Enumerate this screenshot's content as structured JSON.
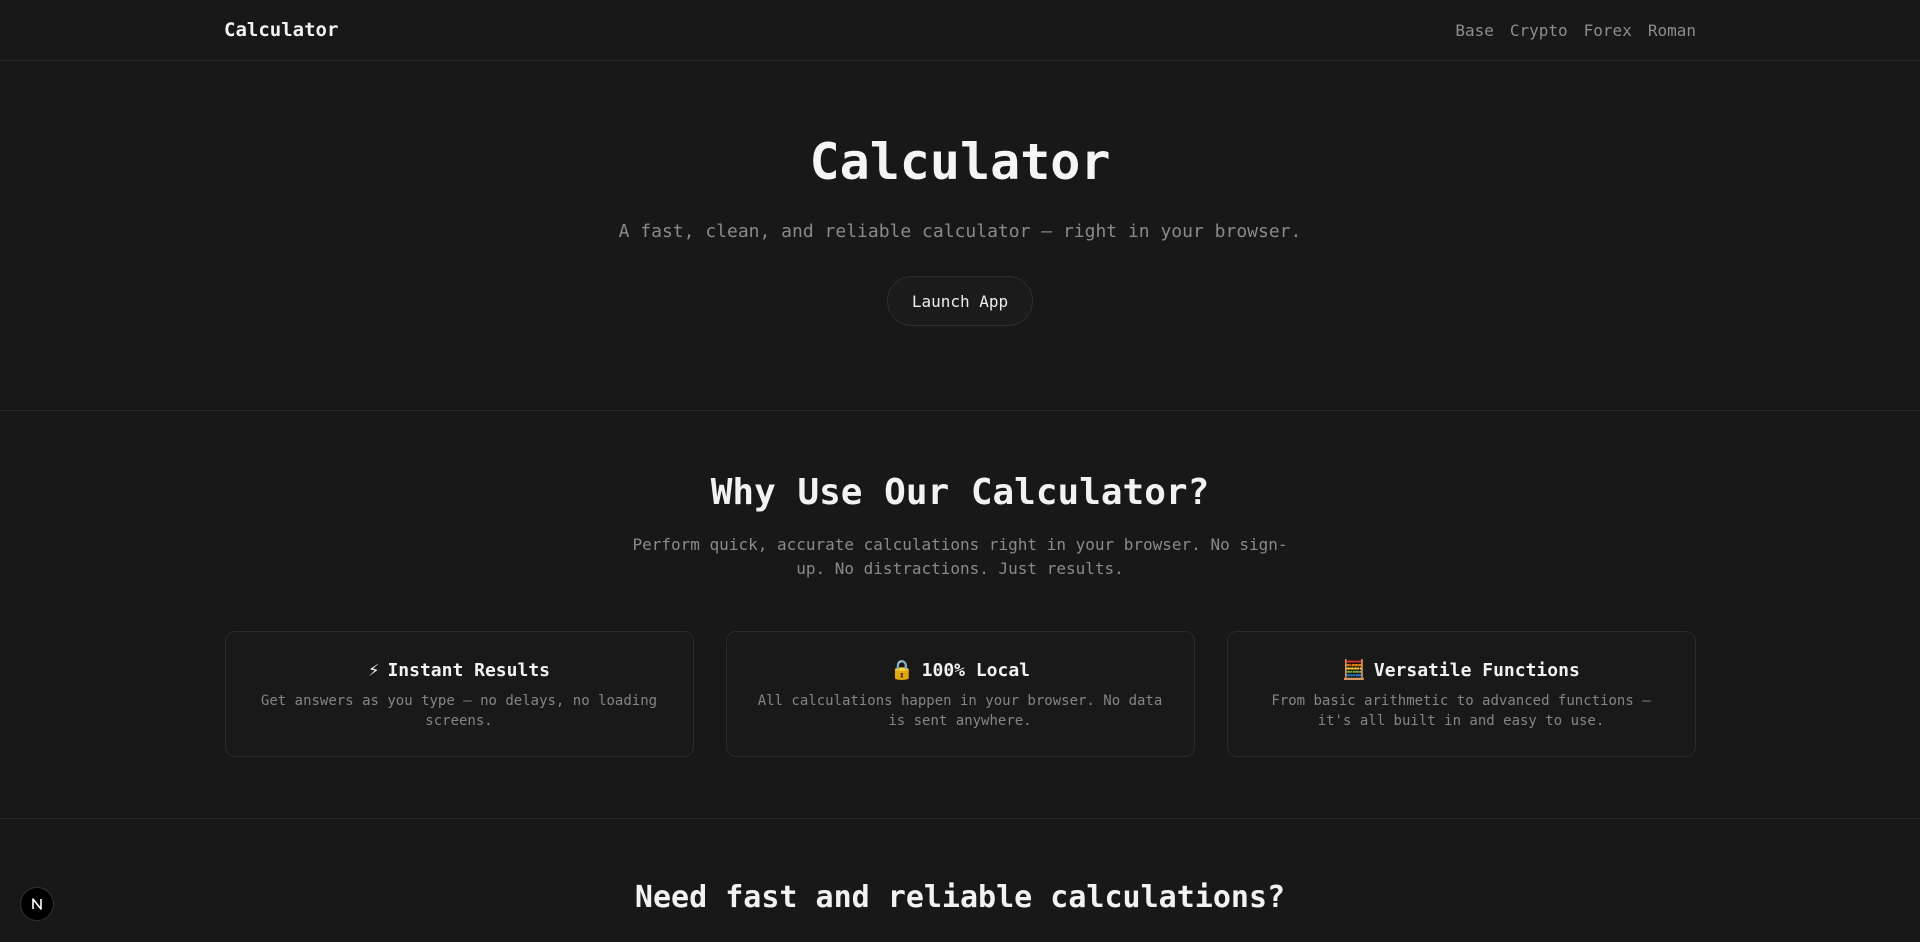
{
  "navbar": {
    "brand": "Calculator",
    "links": [
      "Base",
      "Crypto",
      "Forex",
      "Roman"
    ]
  },
  "hero": {
    "title": "Calculator",
    "subtitle": "A fast, clean, and reliable calculator — right in your browser.",
    "launch_label": "Launch App"
  },
  "features": {
    "title": "Why Use Our Calculator?",
    "subtitle": "Perform quick, accurate calculations right in your browser. No sign-up. No distractions. Just results.",
    "cards": [
      {
        "icon": "⚡",
        "icon_name": "lightning-icon",
        "title": "Instant Results",
        "description": "Get answers as you type — no delays, no loading screens."
      },
      {
        "icon": "🔒",
        "icon_name": "lock-icon",
        "title": "100% Local",
        "description": "All calculations happen in your browser. No data is sent anywhere."
      },
      {
        "icon": "🧮",
        "icon_name": "abacus-icon",
        "title": "Versatile Functions",
        "description": "From basic arithmetic to advanced functions — it's all built in and easy to use."
      }
    ]
  },
  "cta": {
    "title": "Need fast and reliable calculations?"
  },
  "colors": {
    "background": "#181818",
    "border": "#2a2a2a",
    "text_primary": "#f2f2f2",
    "text_muted": "#8a8a8a"
  }
}
